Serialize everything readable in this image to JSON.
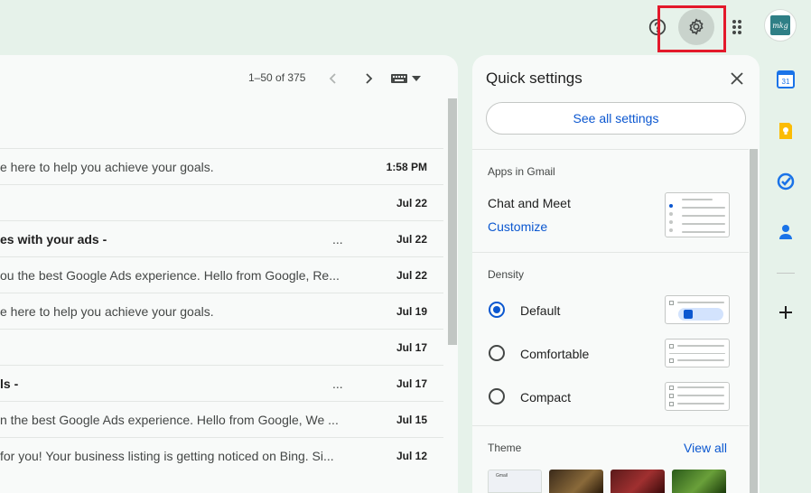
{
  "header": {
    "help_icon": "help-circle-icon",
    "settings_icon": "gear-icon",
    "apps_icon": "apps-grid-icon",
    "avatar_text": "mkg",
    "highlight_color": "#e3192b"
  },
  "mail": {
    "page_range": "1–50 of 375",
    "rows": [
      {
        "snippet": "e here to help you achieve your goals.",
        "date": "1:58 PM",
        "bold": false,
        "dots": ""
      },
      {
        "snippet": "",
        "date": "Jul 22",
        "bold": false,
        "dots": ""
      },
      {
        "snippet": "es with your ads -",
        "date": "Jul 22",
        "bold": true,
        "dots": "..."
      },
      {
        "snippet": "ou the best Google Ads experience. Hello from Google, Re...",
        "date": "Jul 22",
        "bold": false,
        "dots": ""
      },
      {
        "snippet": "e here to help you achieve your goals.",
        "date": "Jul 19",
        "bold": false,
        "dots": ""
      },
      {
        "snippet": "",
        "date": "Jul 17",
        "bold": false,
        "dots": ""
      },
      {
        "snippet": "ls -",
        "date": "Jul 17",
        "bold": true,
        "dots": "..."
      },
      {
        "snippet": "n the best Google Ads experience. Hello from Google, We ...",
        "date": "Jul 15",
        "bold": false,
        "dots": ""
      },
      {
        "snippet": "for you! Your business listing is getting noticed on Bing. Si...",
        "date": "Jul 12",
        "bold": false,
        "dots": ""
      }
    ]
  },
  "quick_settings": {
    "title": "Quick settings",
    "see_all": "See all settings",
    "apps_label": "Apps in Gmail",
    "chat_meet": "Chat and Meet",
    "customize": "Customize",
    "density_label": "Density",
    "density_options": [
      {
        "label": "Default",
        "selected": true
      },
      {
        "label": "Comfortable",
        "selected": false
      },
      {
        "label": "Compact",
        "selected": false
      }
    ],
    "theme_label": "Theme",
    "view_all": "View all",
    "theme_preview_text": "Gmail"
  },
  "side_panel": {
    "items": [
      "calendar-icon",
      "keep-icon",
      "tasks-icon",
      "contacts-icon",
      "add-icon"
    ],
    "calendar_day": "31"
  },
  "colors": {
    "accent": "#0b57d0",
    "background": "#e6f2ea",
    "surface": "#f8faf9"
  }
}
